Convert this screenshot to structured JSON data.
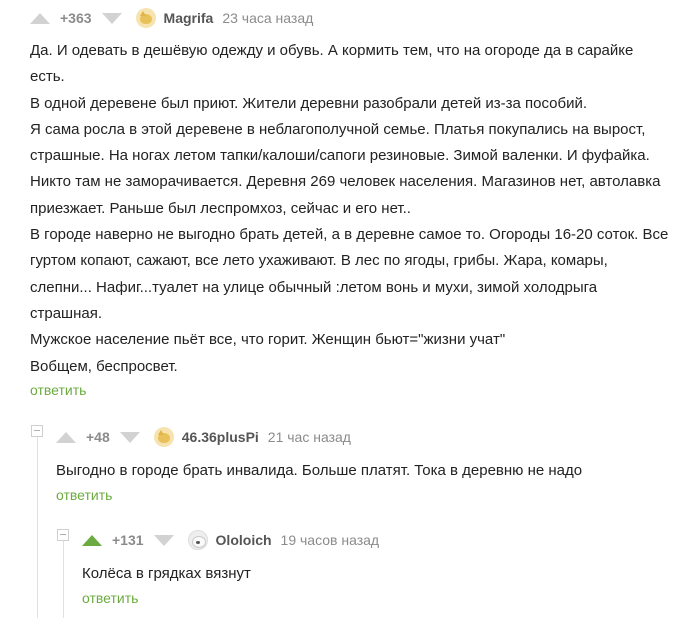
{
  "comments": [
    {
      "rating": "+363",
      "username": "Magrifa",
      "time": "23 часа назад",
      "avatar_icon": "cat-avatar",
      "lines": [
        "Да. И одевать в дешёвую одежду и обувь. А кормить тем, что на огороде да в сарайке",
        "есть.",
        "В одной деревене был приют. Жители деревни разобрали детей из-за пособий.",
        "Я сама росла в этой деревене в неблагополучной семье. Платья покупались на вырост,",
        "страшные. На ногах летом тапки/калоши/сапоги резиновые. Зимой валенки. И фуфайка.",
        "Никто там не заморачивается. Деревня 269 человек населения. Магазинов нет, автолавка",
        "приезжает. Раньше был леспромхоз, сейчас и его нет..",
        "В городе наверно не выгодно брать детей, а в деревне самое то. Огороды 16-20 соток. Все",
        "гуртом копают, сажают, все лето ухаживают. В лес по ягоды, грибы. Жара, комары,",
        "слепни... Нафиг...туалет на улице обычный :летом вонь и мухи, зимой холодрыга",
        "страшная.",
        "Мужское население пьёт все, что горит. Женщин бьют=\"жизни учат\"",
        "Вобщем, беспросвет."
      ],
      "reply_label": "ответить",
      "upvoted": false
    },
    {
      "rating": "+48",
      "username": "46.36plusPi",
      "time": "21 час назад",
      "avatar_icon": "cat-avatar",
      "lines": [
        "Выгодно в городе брать инвалида. Больше платят. Тока в деревню не надо"
      ],
      "reply_label": "ответить",
      "upvoted": false
    },
    {
      "rating": "+131",
      "username": "Ololoich",
      "time": "19 часов назад",
      "avatar_icon": "dog-avatar",
      "lines": [
        "Колёса в грядках вязнут"
      ],
      "reply_label": "ответить",
      "upvoted": true,
      "accent": "#6cab3f"
    }
  ]
}
